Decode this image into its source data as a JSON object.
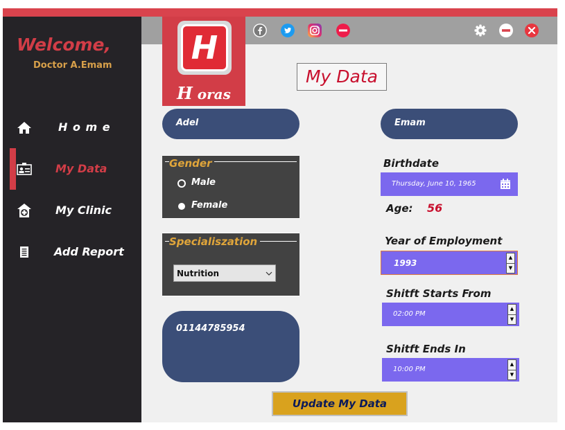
{
  "sidebar": {
    "welcome": "Welcome,",
    "doctor": "Doctor A.Emam",
    "items": [
      {
        "label": "H o m e"
      },
      {
        "label": "My Data"
      },
      {
        "label": "My Clinic"
      },
      {
        "label": "Add Report"
      }
    ]
  },
  "logo": {
    "letter": "H",
    "word_first": "H",
    "word_rest": " oras"
  },
  "header": {
    "title": "My Data"
  },
  "form": {
    "first_name": "Adel",
    "last_name": "Emam",
    "gender": {
      "legend": "Gender",
      "options": [
        {
          "label": "Male"
        },
        {
          "label": "Female"
        }
      ],
      "selected": "Female"
    },
    "specialization": {
      "legend": "Specialiszation",
      "value": "Nutrition"
    },
    "phone": "01144785954",
    "birthdate": {
      "label": "Birthdate",
      "value": "Thursday,  June  10, 1965"
    },
    "age": {
      "label": "Age:",
      "value": "56"
    },
    "employment": {
      "label": "Year of Employment",
      "value": "1993"
    },
    "shift_start": {
      "label": "Shitft Starts From",
      "value": "02:00 PM"
    },
    "shift_end": {
      "label": "Shitft Ends In",
      "value": "10:00 PM"
    },
    "update_label": "Update My Data"
  },
  "colors": {
    "accent": "#d23d47",
    "sidebar_bg": "#252327",
    "pill_bg": "#3b4e78",
    "purple_field": "#7b68ee",
    "legend_orange": "#e0a53a",
    "update_btn": "#d9a21e"
  },
  "icons": {
    "social": [
      "facebook-icon",
      "twitter-icon",
      "instagram-icon",
      "askfm-icon"
    ],
    "window": [
      "gear-icon",
      "minimize-icon",
      "close-icon"
    ]
  }
}
